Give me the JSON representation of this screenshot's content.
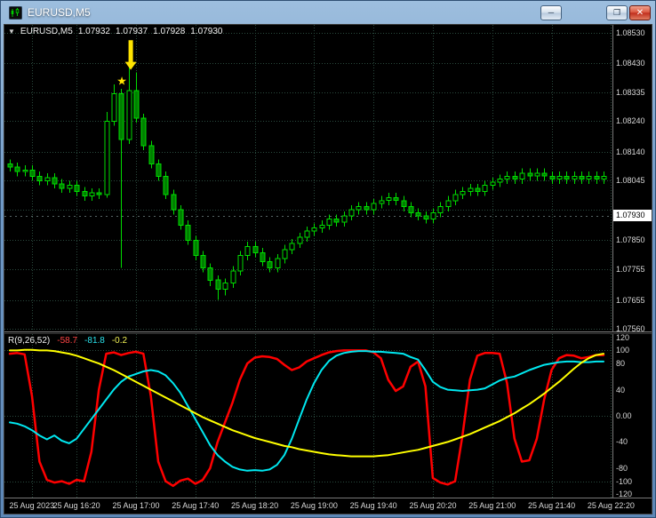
{
  "window": {
    "title": "EURUSD,M5",
    "buttons": {
      "minimize": "─",
      "restore": "❐",
      "close": "✕"
    }
  },
  "header": {
    "expander": "▼",
    "symbol": "EURUSD,M5",
    "open": "1.07932",
    "high": "1.07937",
    "low": "1.07928",
    "close": "1.07930"
  },
  "colors": {
    "background": "#000000",
    "grid": "#2a4a3e",
    "candle_outline": "#00dd00",
    "bull_fill": "#000000",
    "bear_fill": "#008000",
    "axis_text": "#d8d8d8",
    "price_box_bg": "#ffffff",
    "price_box_text": "#000000",
    "bid_line": "#566464",
    "annotation_yellow": "#ffe400",
    "indicator_red": "#ff0000",
    "indicator_aqua": "#00e8f0",
    "indicator_yellow": "#ffff00"
  },
  "chart_data": {
    "type": "candlestick",
    "symbol": "EURUSD",
    "timeframe": "M5",
    "candles": [
      [
        1.081,
        1.08115,
        1.08075,
        1.0809
      ],
      [
        1.0809,
        1.08105,
        1.0806,
        1.08075
      ],
      [
        1.08075,
        1.08095,
        1.0806,
        1.0808
      ],
      [
        1.0808,
        1.08095,
        1.08045,
        1.0806
      ],
      [
        1.0806,
        1.08075,
        1.0803,
        1.08045
      ],
      [
        1.08045,
        1.0807,
        1.0803,
        1.08055
      ],
      [
        1.08055,
        1.0807,
        1.0802,
        1.08035
      ],
      [
        1.08035,
        1.0805,
        1.08005,
        1.0802
      ],
      [
        1.0802,
        1.08045,
        1.08005,
        1.0803
      ],
      [
        1.0803,
        1.08045,
        1.07995,
        1.0801
      ],
      [
        1.0801,
        1.08025,
        1.0798,
        1.07995
      ],
      [
        1.07995,
        1.0802,
        1.0798,
        1.08005
      ],
      [
        1.08005,
        1.0802,
        1.07985,
        1.08
      ],
      [
        1.08,
        1.0827,
        1.0799,
        1.0824
      ],
      [
        1.0824,
        1.0836,
        1.08225,
        1.0833
      ],
      [
        1.0833,
        1.08345,
        1.0776,
        1.0818
      ],
      [
        1.0818,
        1.0843,
        1.08165,
        1.0834
      ],
      [
        1.0834,
        1.084,
        1.08235,
        1.0825
      ],
      [
        1.0825,
        1.08265,
        1.08145,
        1.0816
      ],
      [
        1.0816,
        1.08175,
        1.08085,
        1.081
      ],
      [
        1.081,
        1.08115,
        1.08045,
        1.0806
      ],
      [
        1.0806,
        1.08075,
        1.07985,
        1.08
      ],
      [
        1.08,
        1.08015,
        1.07935,
        1.0795
      ],
      [
        1.0795,
        1.07965,
        1.07885,
        1.079
      ],
      [
        1.079,
        1.07915,
        1.07835,
        1.0785
      ],
      [
        1.0785,
        1.07865,
        1.07785,
        1.078
      ],
      [
        1.078,
        1.07815,
        1.07745,
        1.0776
      ],
      [
        1.0776,
        1.07775,
        1.077,
        1.0772
      ],
      [
        1.0772,
        1.07735,
        1.07655,
        1.0769
      ],
      [
        1.0769,
        1.07725,
        1.0767,
        1.0771
      ],
      [
        1.0771,
        1.07765,
        1.07695,
        1.0775
      ],
      [
        1.0775,
        1.07815,
        1.07735,
        1.078
      ],
      [
        1.078,
        1.07845,
        1.07785,
        1.0783
      ],
      [
        1.0783,
        1.07845,
        1.07795,
        1.0781
      ],
      [
        1.0781,
        1.07825,
        1.07765,
        1.0778
      ],
      [
        1.0778,
        1.07795,
        1.07745,
        1.0776
      ],
      [
        1.0776,
        1.07805,
        1.07745,
        1.0779
      ],
      [
        1.0779,
        1.07835,
        1.07775,
        1.0782
      ],
      [
        1.0782,
        1.07855,
        1.07805,
        1.0784
      ],
      [
        1.0784,
        1.07875,
        1.07825,
        1.0786
      ],
      [
        1.0786,
        1.07895,
        1.07845,
        1.0788
      ],
      [
        1.0788,
        1.07905,
        1.07865,
        1.0789
      ],
      [
        1.0789,
        1.07915,
        1.07875,
        1.079
      ],
      [
        1.079,
        1.07935,
        1.07885,
        1.0792
      ],
      [
        1.0792,
        1.07935,
        1.07895,
        1.0791
      ],
      [
        1.0791,
        1.07945,
        1.07895,
        1.0793
      ],
      [
        1.0793,
        1.07965,
        1.07915,
        1.0795
      ],
      [
        1.0795,
        1.07975,
        1.07935,
        1.0796
      ],
      [
        1.0796,
        1.07975,
        1.07935,
        1.0795
      ],
      [
        1.0795,
        1.07985,
        1.07935,
        1.0797
      ],
      [
        1.0797,
        1.07995,
        1.07955,
        1.0798
      ],
      [
        1.0798,
        1.08005,
        1.07965,
        1.0799
      ],
      [
        1.0799,
        1.08005,
        1.07965,
        1.0798
      ],
      [
        1.0798,
        1.07995,
        1.07945,
        1.0796
      ],
      [
        1.0796,
        1.07975,
        1.07925,
        1.0794
      ],
      [
        1.0794,
        1.07955,
        1.07915,
        1.0793
      ],
      [
        1.0793,
        1.07945,
        1.07905,
        1.0792
      ],
      [
        1.0792,
        1.07955,
        1.07905,
        1.0794
      ],
      [
        1.0794,
        1.07975,
        1.07925,
        1.0796
      ],
      [
        1.0796,
        1.07995,
        1.07945,
        1.0798
      ],
      [
        1.0798,
        1.08015,
        1.07965,
        1.08
      ],
      [
        1.08,
        1.08025,
        1.07985,
        1.0801
      ],
      [
        1.0801,
        1.08035,
        1.07995,
        1.0802
      ],
      [
        1.0802,
        1.08035,
        1.07995,
        1.0801
      ],
      [
        1.0801,
        1.08045,
        1.07995,
        1.0803
      ],
      [
        1.0803,
        1.08055,
        1.08015,
        1.0804
      ],
      [
        1.0804,
        1.08065,
        1.08025,
        1.0805
      ],
      [
        1.0805,
        1.08075,
        1.08035,
        1.0806
      ],
      [
        1.0806,
        1.08075,
        1.08035,
        1.0805
      ],
      [
        1.0805,
        1.08085,
        1.08035,
        1.0807
      ],
      [
        1.0807,
        1.08085,
        1.08045,
        1.0806
      ],
      [
        1.0806,
        1.08085,
        1.08045,
        1.0807
      ],
      [
        1.0807,
        1.08085,
        1.08045,
        1.0806
      ],
      [
        1.0806,
        1.08075,
        1.08035,
        1.0805
      ],
      [
        1.0805,
        1.08075,
        1.08035,
        1.0806
      ],
      [
        1.0806,
        1.08075,
        1.08035,
        1.0805
      ],
      [
        1.0805,
        1.08075,
        1.08035,
        1.0806
      ],
      [
        1.0806,
        1.08075,
        1.08035,
        1.0805
      ],
      [
        1.0805,
        1.08075,
        1.08035,
        1.0806
      ],
      [
        1.0806,
        1.08075,
        1.08035,
        1.0805
      ],
      [
        1.0805,
        1.08075,
        1.08035,
        1.0806
      ]
    ],
    "price_axis": {
      "visible_range": [
        1.07552,
        1.08555
      ],
      "labels": [
        {
          "text": "1.08530",
          "price": 1.0853
        },
        {
          "text": "1.08430",
          "price": 1.0843
        },
        {
          "text": "1.08335",
          "price": 1.08335
        },
        {
          "text": "1.08240",
          "price": 1.0824
        },
        {
          "text": "1.08140",
          "price": 1.0814
        },
        {
          "text": "1.08045",
          "price": 1.08045
        },
        {
          "text": "1.07850",
          "price": 1.0785
        },
        {
          "text": "1.07755",
          "price": 1.07755
        },
        {
          "text": "1.07655",
          "price": 1.07655
        },
        {
          "text": "1.07560",
          "price": 1.0756
        }
      ],
      "grid_prices": [
        1.0853,
        1.0843,
        1.08335,
        1.0824,
        1.0814,
        1.08045,
        1.0795,
        1.0785,
        1.07755,
        1.07655,
        1.0756
      ],
      "price_box": {
        "text": "1.07930",
        "price": 1.0793
      }
    },
    "time_axis": [
      {
        "text": "25 Aug 2023",
        "index": 3
      },
      {
        "text": "25 Aug 16:20",
        "index": 9
      },
      {
        "text": "25 Aug 17:00",
        "index": 17
      },
      {
        "text": "25 Aug 17:40",
        "index": 25
      },
      {
        "text": "25 Aug 18:20",
        "index": 33
      },
      {
        "text": "25 Aug 19:00",
        "index": 41
      },
      {
        "text": "25 Aug 19:40",
        "index": 49
      },
      {
        "text": "25 Aug 20:20",
        "index": 57
      },
      {
        "text": "25 Aug 21:00",
        "index": 65
      },
      {
        "text": "25 Aug 21:40",
        "index": 73
      },
      {
        "text": "25 Aug 22:20",
        "index": 81
      }
    ],
    "annotations": {
      "arrow_down": {
        "index": 16.3,
        "tail_price": 1.08505,
        "tip_price": 1.08408,
        "color": "#ffe400"
      },
      "star": {
        "glyph": "★",
        "index": 15.1,
        "price": 1.08372,
        "color": "#ffe400"
      }
    },
    "indicator": {
      "label": "R(9,26,52)",
      "values": [
        "-58.7",
        "-81.8",
        "-0.2"
      ],
      "scale_range": [
        -125,
        125
      ],
      "axis_labels": [
        {
          "text": "120",
          "value": 120
        },
        {
          "text": "100",
          "value": 100
        },
        {
          "text": "80",
          "value": 80
        },
        {
          "text": "40",
          "value": 40
        },
        {
          "text": "0.00",
          "value": 0
        },
        {
          "text": "-40",
          "value": -40
        },
        {
          "text": "-80",
          "value": -80
        },
        {
          "text": "-100",
          "value": -100
        },
        {
          "text": "-120",
          "value": -120
        }
      ],
      "grid_values": [
        100,
        0,
        -100
      ],
      "series": [
        {
          "name": "r-fast-red",
          "color": "#ff0000",
          "width": 2.5,
          "values": [
            95,
            96,
            94,
            30,
            -70,
            -98,
            -102,
            -100,
            -104,
            -98,
            -100,
            -55,
            40,
            95,
            97,
            93,
            96,
            98,
            95,
            30,
            -70,
            -100,
            -107,
            -99,
            -96,
            -104,
            -98,
            -80,
            -40,
            -10,
            20,
            55,
            80,
            89,
            91,
            90,
            87,
            78,
            70,
            74,
            83,
            88,
            93,
            97,
            99,
            100,
            100,
            100,
            100,
            97,
            88,
            55,
            38,
            45,
            75,
            83,
            45,
            -95,
            -102,
            -105,
            -100,
            -30,
            55,
            92,
            96,
            96,
            95,
            50,
            -35,
            -70,
            -68,
            -35,
            25,
            70,
            88,
            93,
            92,
            88,
            90,
            93,
            93
          ]
        },
        {
          "name": "r-mid-aqua",
          "color": "#00e8f0",
          "width": 2,
          "values": [
            -10,
            -12,
            -16,
            -22,
            -30,
            -36,
            -30,
            -38,
            -42,
            -35,
            -20,
            -5,
            10,
            25,
            40,
            52,
            60,
            64,
            68,
            70,
            68,
            62,
            50,
            35,
            15,
            -5,
            -25,
            -45,
            -60,
            -70,
            -78,
            -82,
            -84,
            -83,
            -84,
            -82,
            -75,
            -60,
            -35,
            -5,
            25,
            50,
            70,
            84,
            92,
            96,
            98,
            99,
            99,
            98,
            98,
            97,
            96,
            95,
            90,
            86,
            70,
            52,
            44,
            40,
            39,
            38,
            39,
            40,
            42,
            48,
            54,
            58,
            60,
            65,
            70,
            74,
            78,
            80,
            82,
            83,
            83,
            82,
            82,
            83,
            83
          ]
        },
        {
          "name": "r-slow-yellow",
          "color": "#ffff00",
          "width": 2,
          "values": [
            100,
            100,
            101,
            101,
            100,
            100,
            99,
            97,
            95,
            92,
            88,
            84,
            80,
            75,
            70,
            64,
            58,
            52,
            46,
            40,
            34,
            28,
            22,
            16,
            10,
            4,
            -2,
            -7,
            -12,
            -17,
            -22,
            -26,
            -30,
            -34,
            -37,
            -40,
            -43,
            -46,
            -48,
            -51,
            -53,
            -55,
            -57,
            -59,
            -60,
            -61,
            -62,
            -62,
            -62,
            -62,
            -61,
            -60,
            -58,
            -56,
            -54,
            -52,
            -49,
            -46,
            -43,
            -40,
            -36,
            -32,
            -28,
            -23,
            -18,
            -13,
            -8,
            -2,
            4,
            11,
            18,
            26,
            34,
            43,
            52,
            62,
            72,
            81,
            88,
            93,
            95
          ]
        }
      ]
    }
  }
}
